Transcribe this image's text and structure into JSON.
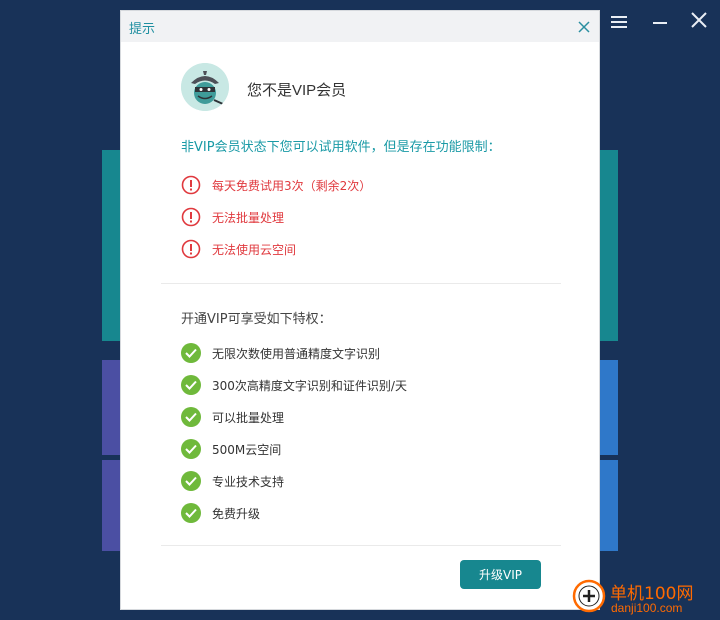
{
  "colors": {
    "background": "#183258",
    "teal_panel": "#17878f",
    "purple_panel": "#4b4fa3",
    "blue_panel": "#2f78c9",
    "accent_text": "#1a9aa6",
    "warning": "#e0393e",
    "success": "#6fb93b"
  },
  "window_controls": {
    "menu_icon": "hamburger-menu-icon",
    "minimize_icon": "minimize-icon",
    "close_icon": "close-icon"
  },
  "dialog": {
    "title": "提示",
    "close_icon": "close-icon",
    "avatar_icon": "ninja-avatar-icon",
    "status_title": "您不是VIP会员",
    "intro": "非VIP会员状态下您可以试用软件，但是存在功能限制：",
    "limitations": [
      {
        "text": "每天免费试用3次（剩余2次）",
        "icon": "exclamation-circle-icon"
      },
      {
        "text": "无法批量处理",
        "icon": "exclamation-circle-icon"
      },
      {
        "text": "无法使用云空间",
        "icon": "exclamation-circle-icon"
      }
    ],
    "benefits_title": "开通VIP可享受如下特权：",
    "benefits": [
      {
        "text": "无限次数使用普通精度文字识别",
        "icon": "check-circle-icon"
      },
      {
        "text": "300次高精度文字识别和证件识别/天",
        "icon": "check-circle-icon"
      },
      {
        "text": "可以批量处理",
        "icon": "check-circle-icon"
      },
      {
        "text": "500M云空间",
        "icon": "check-circle-icon"
      },
      {
        "text": "专业技术支持",
        "icon": "check-circle-icon"
      },
      {
        "text": "免费升级",
        "icon": "check-circle-icon"
      }
    ],
    "upgrade_button": "升级VIP"
  },
  "watermark": {
    "name": "单机100网",
    "domain": "danji100.com"
  }
}
